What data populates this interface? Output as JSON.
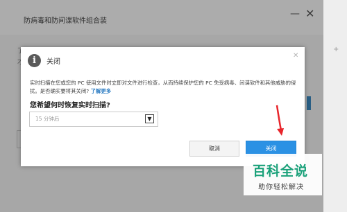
{
  "background_window": {
    "title": "防病毒和防间谍软件组合装",
    "minimize_icon": "minimize-icon",
    "close_icon": "close-icon",
    "left_fragment": "了\n才"
  },
  "right_panel_fragment": "+",
  "dialog": {
    "title": "关闭",
    "message": "实时扫描在您或您的 PC 使用文件时立即对文件进行检查，从而持续保护您的 PC 免受病毒、间谍软件和其他威胁的侵扰。是否确实要将其关闭?",
    "link": "了解更多",
    "question": "您希望何时恢复实时扫描?",
    "select_value": "15 分钟后",
    "cancel_label": "取消",
    "close_label": "关闭",
    "icons": {
      "info": "info-icon",
      "close": "close-icon",
      "dropdown": "chevron-down-icon"
    }
  },
  "watermark": {
    "main": "百科全说",
    "sub": "助你轻松解决"
  },
  "colors": {
    "accent": "#2b91e4",
    "annotation_arrow": "#e8252b",
    "watermark_green": "#1aa17a"
  }
}
